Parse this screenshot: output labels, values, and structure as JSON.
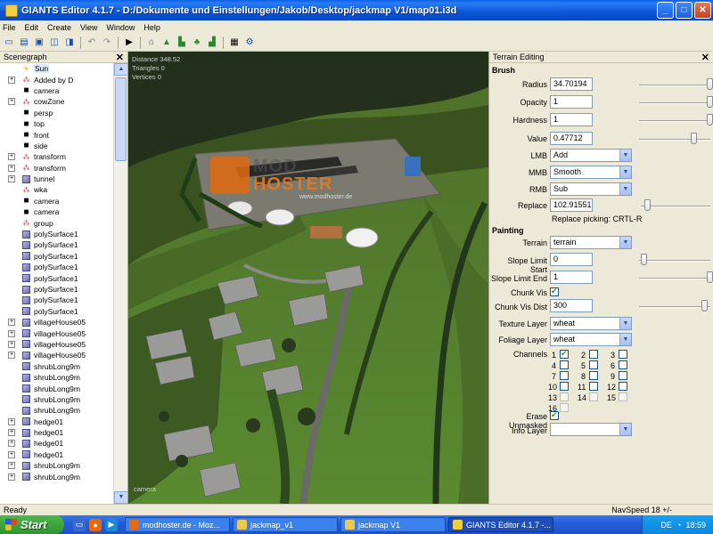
{
  "window": {
    "title": "GIANTS Editor 4.1.7 - D:/Dokumente und Einstellungen/Jakob/Desktop/jackmap V1/map01.i3d",
    "minimize": "_",
    "maximize": "□",
    "close": "✕"
  },
  "menu": [
    "File",
    "Edit",
    "Create",
    "View",
    "Window",
    "Help"
  ],
  "toolbar": {
    "icons": [
      "new-icon",
      "open-icon",
      "save-icon",
      "import-icon",
      "export-icon",
      "undo-icon",
      "redo-icon",
      "play-icon",
      "select-icon",
      "terrain-sculpt-icon",
      "terrain-paint-icon",
      "foliage-paint-icon",
      "foliage-icon",
      "checker-icon",
      "settings-icon"
    ]
  },
  "scenegraph": {
    "title": "Scenegraph",
    "close": "✕",
    "items": [
      {
        "label": "Sun",
        "icon": "sun-icon",
        "expander": false,
        "selected": true
      },
      {
        "label": "Added by D",
        "icon": "group-icon",
        "expander": true
      },
      {
        "label": "camera",
        "icon": "camera-icon",
        "expander": false
      },
      {
        "label": "cowZone",
        "icon": "group-icon",
        "expander": true
      },
      {
        "label": "persp",
        "icon": "camera-icon",
        "expander": false
      },
      {
        "label": "top",
        "icon": "camera-icon",
        "expander": false
      },
      {
        "label": "front",
        "icon": "camera-icon",
        "expander": false
      },
      {
        "label": "side",
        "icon": "camera-icon",
        "expander": false
      },
      {
        "label": "transform",
        "icon": "group-icon",
        "expander": true
      },
      {
        "label": "transform",
        "icon": "group-icon",
        "expander": true
      },
      {
        "label": "tunnel",
        "icon": "shape-icon",
        "expander": true
      },
      {
        "label": "wka",
        "icon": "group-icon",
        "expander": false
      },
      {
        "label": "camera",
        "icon": "camera-icon",
        "expander": false
      },
      {
        "label": "camera",
        "icon": "camera-icon",
        "expander": false
      },
      {
        "label": "group",
        "icon": "group-icon",
        "expander": false
      },
      {
        "label": "polySurface1",
        "icon": "shape-icon",
        "expander": false
      },
      {
        "label": "polySurface1",
        "icon": "shape-icon",
        "expander": false
      },
      {
        "label": "polySurface1",
        "icon": "shape-icon",
        "expander": false
      },
      {
        "label": "polySurface1",
        "icon": "shape-icon",
        "expander": false
      },
      {
        "label": "polySurface1",
        "icon": "shape-icon",
        "expander": false
      },
      {
        "label": "polySurface1",
        "icon": "shape-icon",
        "expander": false
      },
      {
        "label": "polySurface1",
        "icon": "shape-icon",
        "expander": false
      },
      {
        "label": "polySurface1",
        "icon": "shape-icon",
        "expander": false
      },
      {
        "label": "villageHouse05",
        "icon": "shape-icon",
        "expander": true
      },
      {
        "label": "villageHouse05",
        "icon": "shape-icon",
        "expander": true
      },
      {
        "label": "villageHouse05",
        "icon": "shape-icon",
        "expander": true
      },
      {
        "label": "villageHouse05",
        "icon": "shape-icon",
        "expander": true
      },
      {
        "label": "shrubLong9m",
        "icon": "shape-icon",
        "expander": false
      },
      {
        "label": "shrubLong9m",
        "icon": "shape-icon",
        "expander": false
      },
      {
        "label": "shrubLong9m",
        "icon": "shape-icon",
        "expander": false
      },
      {
        "label": "shrubLong9m",
        "icon": "shape-icon",
        "expander": false
      },
      {
        "label": "shrubLong9m",
        "icon": "shape-icon",
        "expander": false
      },
      {
        "label": "hedge01",
        "icon": "shape-icon",
        "expander": true
      },
      {
        "label": "hedge01",
        "icon": "shape-icon",
        "expander": true
      },
      {
        "label": "hedge01",
        "icon": "shape-icon",
        "expander": true
      },
      {
        "label": "hedge01",
        "icon": "shape-icon",
        "expander": true
      },
      {
        "label": "shrubLong9m",
        "icon": "shape-icon",
        "expander": true
      },
      {
        "label": "shrubLong9m",
        "icon": "shape-icon",
        "expander": true
      }
    ]
  },
  "viewport": {
    "stats": [
      "Distance 348.52",
      "Triangles 0",
      "Vertices 0"
    ],
    "camera_label": "camera",
    "watermark": {
      "line1": "MOD",
      "line2": "HOSTER",
      "url": "www.modhoster.de"
    }
  },
  "terrain_editing": {
    "title": "Terrain Editing",
    "close": "✕",
    "brush_header": "Brush",
    "radius_label": "Radius",
    "radius_value": "34.70194",
    "opacity_label": "Opacity",
    "opacity_value": "1",
    "hardness_label": "Hardness",
    "hardness_value": "1",
    "value_label": "Value",
    "value_value": "0.47712",
    "lmb_label": "LMB",
    "lmb_value": "Add",
    "mmb_label": "MMB",
    "mmb_value": "Smooth",
    "rmb_label": "RMB",
    "rmb_value": "Sub",
    "replace_label": "Replace",
    "replace_value": "102.91551",
    "replace_picking": "Replace picking: CRTL-R",
    "painting_header": "Painting",
    "terrain_label": "Terrain",
    "terrain_value": "terrain",
    "slope_start_label": "Slope Limit Start",
    "slope_start_value": "0",
    "slope_end_label": "Slope Limit End",
    "slope_end_value": "1",
    "chunk_vis_label": "Chunk Vis",
    "chunk_vis_checked": true,
    "chunk_vis_dist_label": "Chunk Vis Dist",
    "chunk_vis_dist_value": "300",
    "texture_layer_label": "Texture Layer",
    "texture_layer_value": "wheat",
    "foliage_layer_label": "Foliage Layer",
    "foliage_layer_value": "wheat",
    "channels_label": "Channels",
    "channels": [
      {
        "n": "1",
        "checked": true
      },
      {
        "n": "2",
        "checked": false
      },
      {
        "n": "3",
        "checked": false
      },
      {
        "n": "4",
        "checked": false
      },
      {
        "n": "5",
        "checked": false
      },
      {
        "n": "6",
        "checked": false
      },
      {
        "n": "7",
        "checked": false
      },
      {
        "n": "8",
        "checked": false
      },
      {
        "n": "9",
        "checked": false
      },
      {
        "n": "10",
        "checked": false
      },
      {
        "n": "11",
        "checked": false
      },
      {
        "n": "12",
        "checked": false
      },
      {
        "n": "13",
        "checked": false
      },
      {
        "n": "14",
        "checked": false
      },
      {
        "n": "15",
        "checked": false
      },
      {
        "n": "16",
        "checked": false
      }
    ],
    "erase_unmasked_label": "Erase Unmasked",
    "erase_unmasked_checked": true,
    "info_layer_label": "Info Layer",
    "info_layer_value": "",
    "slider_levels": {
      "radius": 1.0,
      "opacity": 1.0,
      "hardness": 1.0,
      "value": 0.78,
      "replace": 0.05,
      "slope_start": 0.02,
      "slope_end": 1.0,
      "chunk_vis_dist": 0.92
    }
  },
  "status": {
    "left": "Ready",
    "navspeed": "NavSpeed 18 +/-"
  },
  "taskbar": {
    "start": "Start",
    "tasks": [
      "modhoster.de - Moz...",
      "jackmap_v1",
      "jackmap V1",
      "GIANTS Editor 4.1.7 -..."
    ],
    "lang": "DE",
    "clock": "18:59"
  },
  "colors": {
    "title_blue": "#0a56d8",
    "taskbar_blue": "#245ed8",
    "start_green": "#2e962e",
    "panel_bg": "#ece9d8",
    "grass": "#4e7a2a"
  }
}
